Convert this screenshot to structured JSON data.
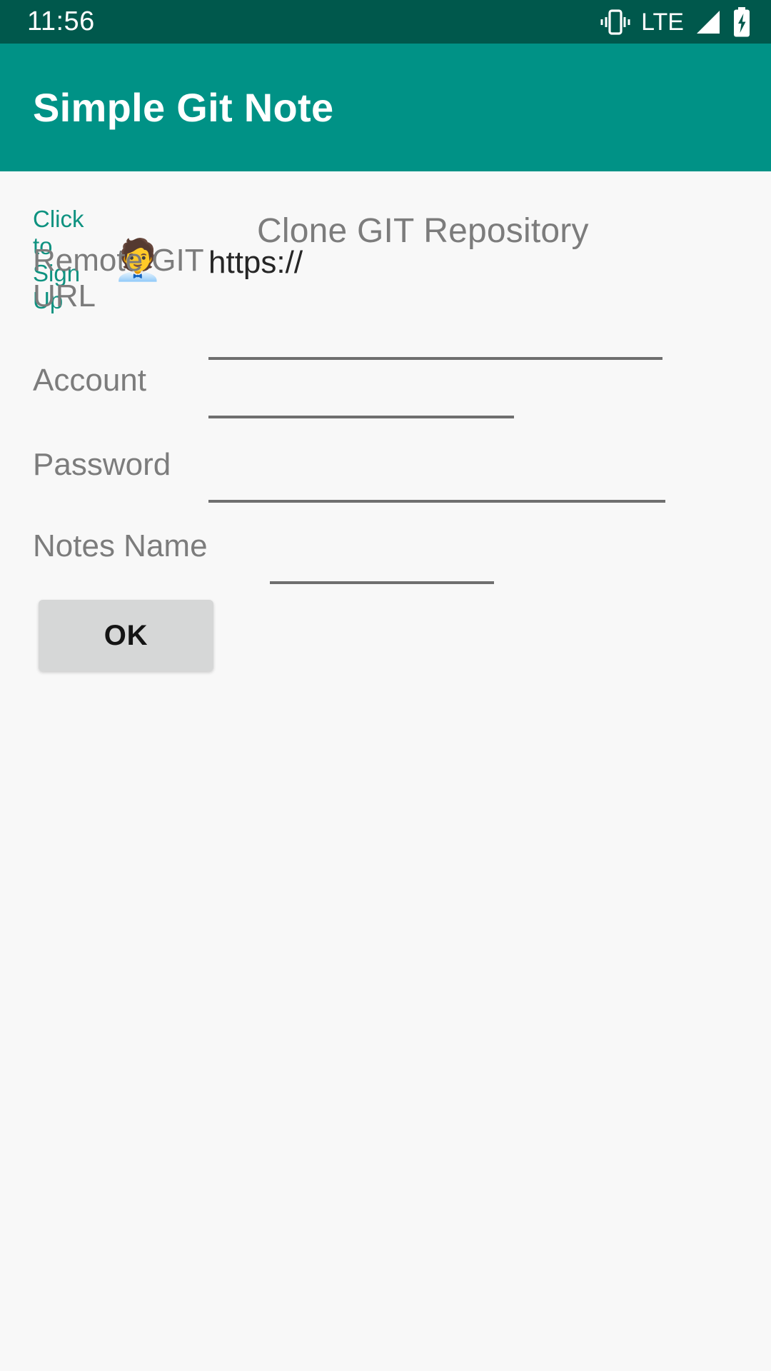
{
  "status_bar": {
    "clock": "11:56",
    "network_label": "LTE",
    "icons": [
      "vibrate-icon",
      "lte-label",
      "signal-icon",
      "battery-charging-icon"
    ],
    "background_color": "#00584c",
    "foreground_color": "#ffffff"
  },
  "app_bar": {
    "title": "Simple Git Note",
    "background_color": "#009286",
    "title_color": "#ffffff"
  },
  "content": {
    "background_color": "#f8f8f8",
    "signup": {
      "label": "Click to\nSign Up",
      "label_line1": "Click to",
      "label_line2": "Sign Up",
      "link_color": "#0e9280",
      "emoji": "🧑‍💼",
      "emoji_name": "person-with-pencil-emoji"
    },
    "section_title": "Clone GIT Repository",
    "section_title_color": "#7c7c7c",
    "fields": [
      {
        "label": "Remote GIT URL",
        "value": "https://",
        "placeholder": "",
        "name": "remote-git-url"
      },
      {
        "label": "Account",
        "value": "",
        "placeholder": "",
        "name": "account"
      },
      {
        "label": "Password",
        "value": "",
        "placeholder": "",
        "name": "password"
      },
      {
        "label": "Notes Name",
        "value": "",
        "placeholder": "",
        "name": "notes-name"
      }
    ],
    "submit_button": {
      "label": "OK",
      "background_color": "#d6d7d7",
      "text_color": "#141414"
    }
  }
}
